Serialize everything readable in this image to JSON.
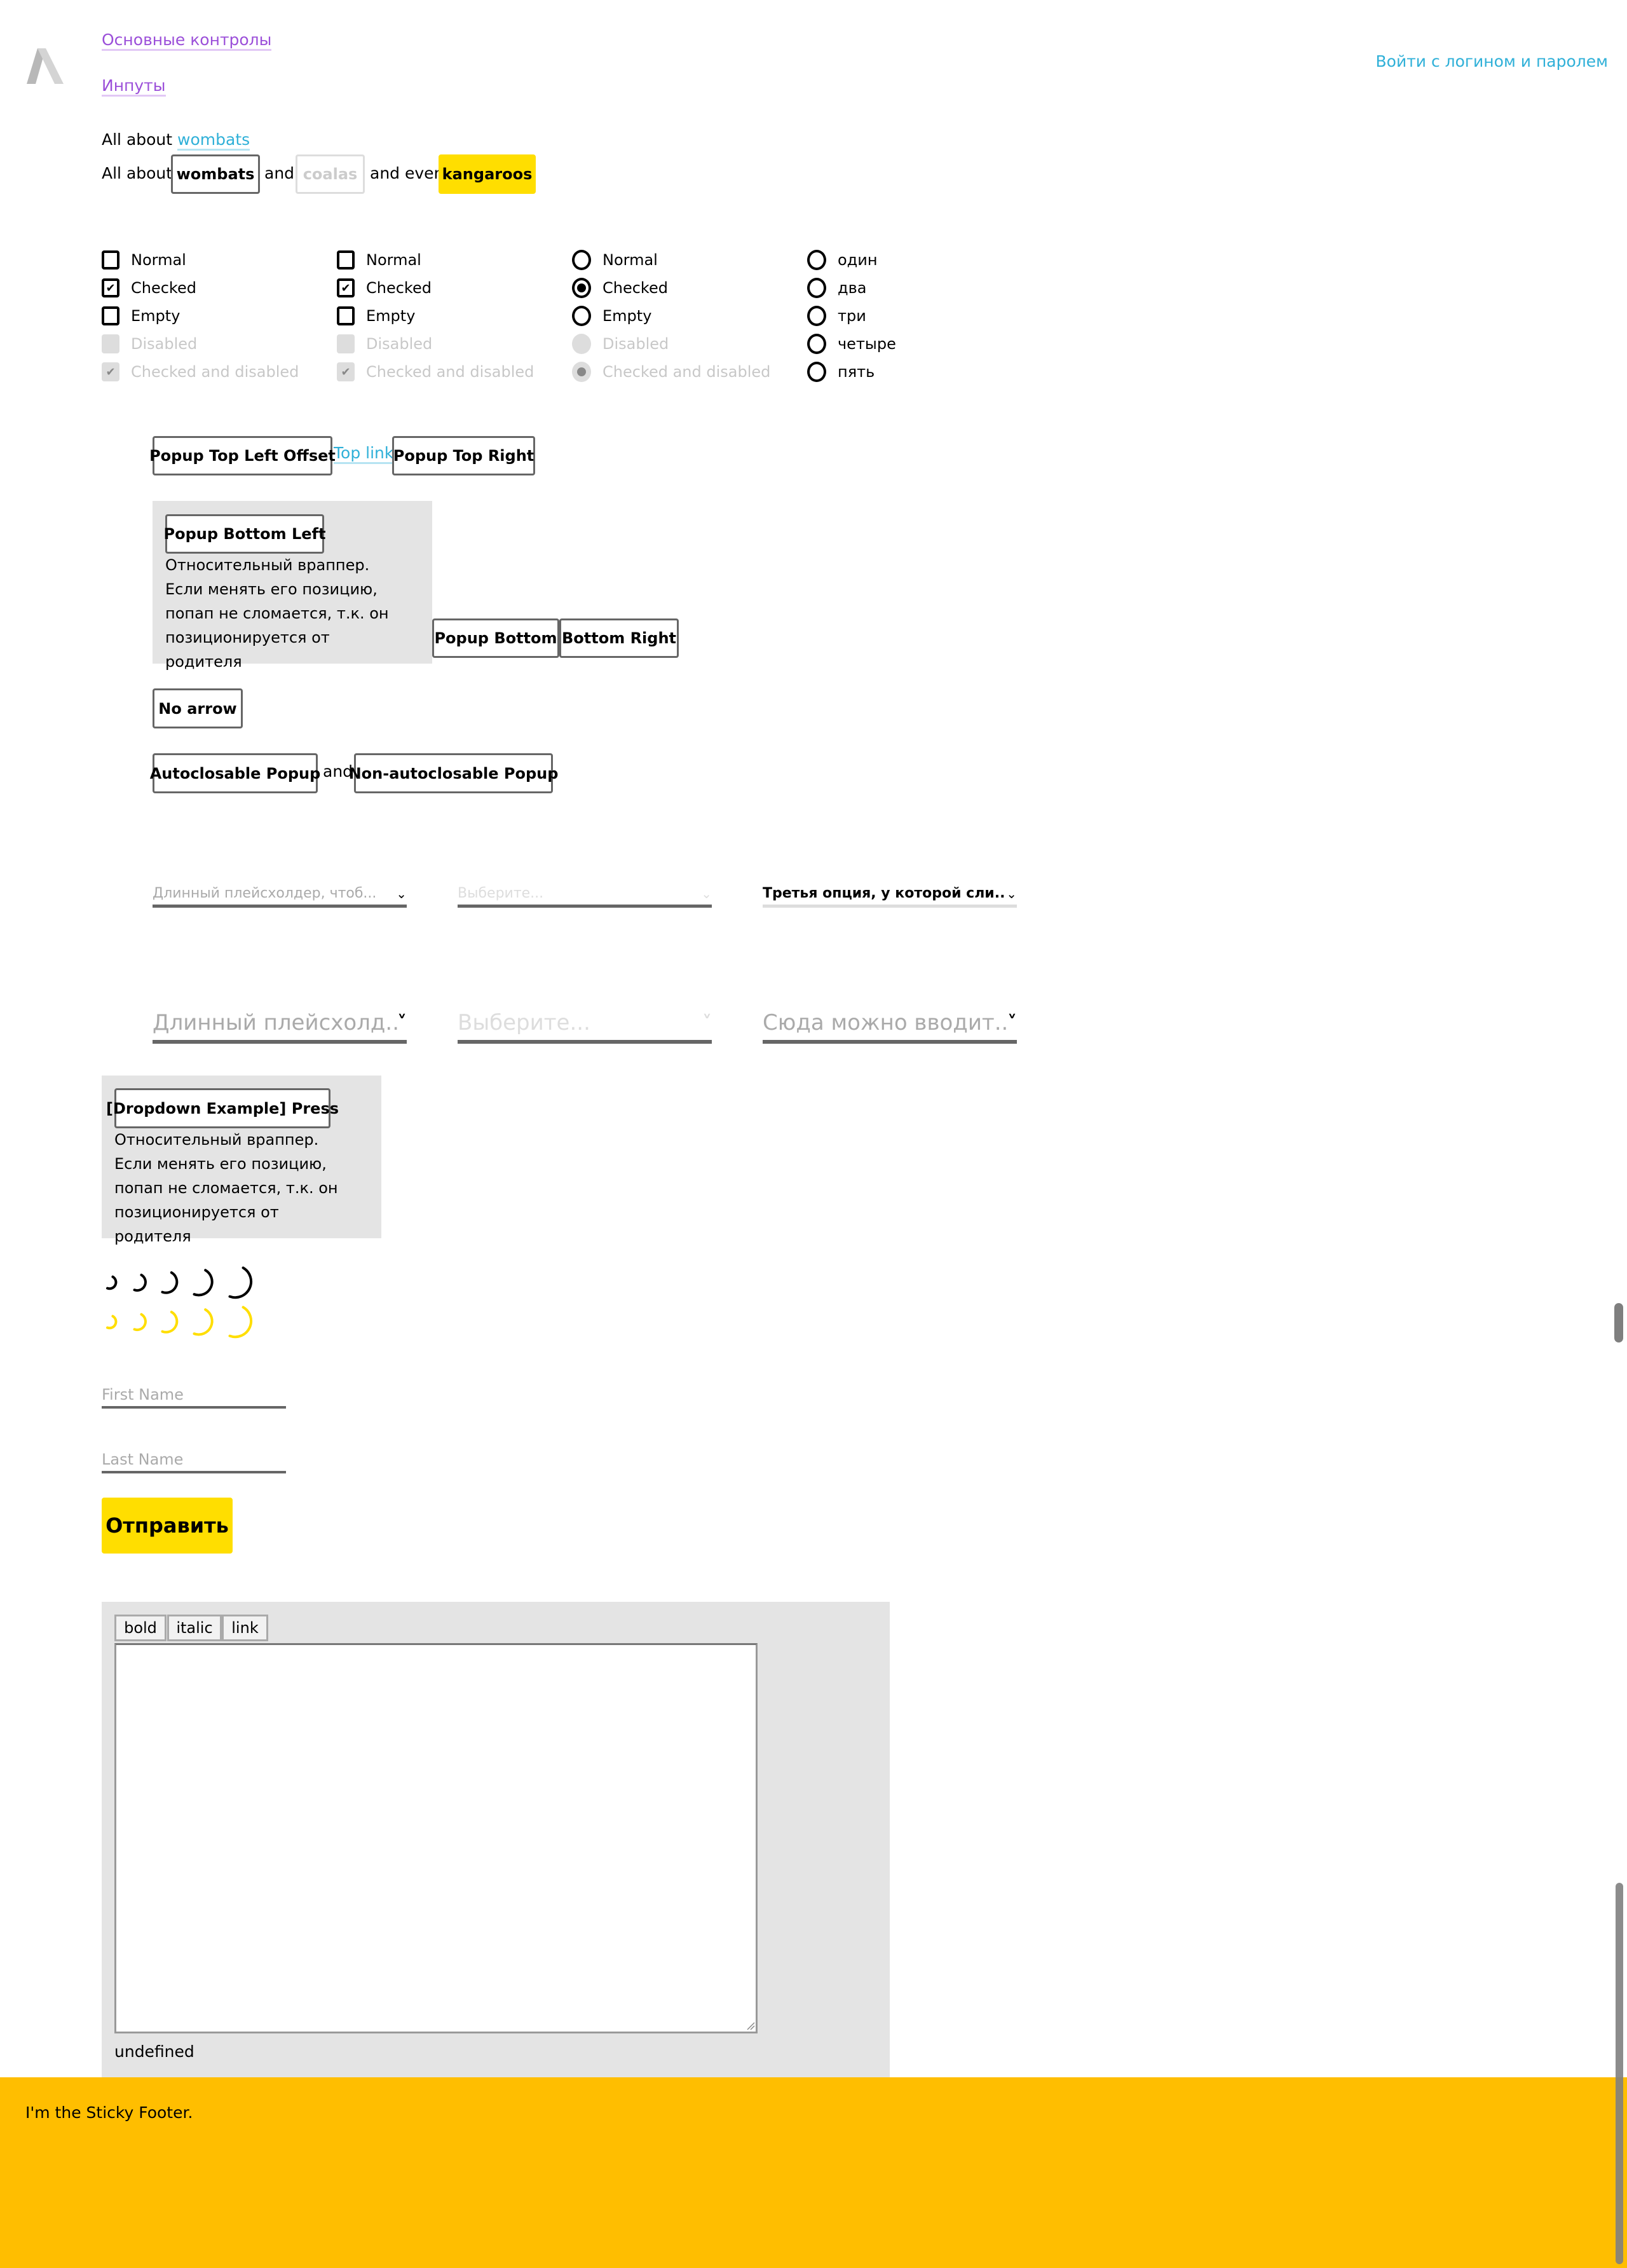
{
  "header": {
    "nav_links": [
      "Основные контролы",
      "Инпуты"
    ],
    "login_link": "Войти с логином и паролем"
  },
  "links_demo": {
    "line1_prefix": "All about",
    "line1_link": "wombats",
    "line2_prefix": "All about",
    "button_wombats": "wombats",
    "and1": "and",
    "button_coalas": "coalas",
    "and_even": "and even",
    "button_kangaroos": "kangaroos"
  },
  "checkbox_groups": [
    {
      "type": "checkbox",
      "items": [
        {
          "label": "Normal",
          "checked": false,
          "disabled": false
        },
        {
          "label": "Checked",
          "checked": true,
          "disabled": false
        },
        {
          "label": "Empty",
          "checked": false,
          "disabled": false
        },
        {
          "label": "Disabled",
          "checked": false,
          "disabled": true
        },
        {
          "label": "Checked and disabled",
          "checked": true,
          "disabled": true
        }
      ]
    },
    {
      "type": "checkbox",
      "items": [
        {
          "label": "Normal",
          "checked": false,
          "disabled": false
        },
        {
          "label": "Checked",
          "checked": true,
          "disabled": false
        },
        {
          "label": "Empty",
          "checked": false,
          "disabled": false
        },
        {
          "label": "Disabled",
          "checked": false,
          "disabled": true
        },
        {
          "label": "Checked and disabled",
          "checked": true,
          "disabled": true
        }
      ]
    },
    {
      "type": "radio",
      "items": [
        {
          "label": "Normal",
          "checked": false,
          "disabled": false
        },
        {
          "label": "Checked",
          "checked": true,
          "disabled": false
        },
        {
          "label": "Empty",
          "checked": false,
          "disabled": false
        },
        {
          "label": "Disabled",
          "checked": false,
          "disabled": true
        },
        {
          "label": "Checked and disabled",
          "checked": true,
          "disabled": true
        }
      ]
    },
    {
      "type": "radio",
      "items": [
        {
          "label": "один",
          "checked": false,
          "disabled": false
        },
        {
          "label": "два",
          "checked": false,
          "disabled": false
        },
        {
          "label": "три",
          "checked": false,
          "disabled": false
        },
        {
          "label": "четыре",
          "checked": false,
          "disabled": false
        },
        {
          "label": "пять",
          "checked": false,
          "disabled": false
        }
      ]
    }
  ],
  "popups": {
    "top_left_offset": "Popup Top Left Offset",
    "top_link": "Top link",
    "top_right": "Popup Top Right",
    "bottom_left": "Popup Bottom Left",
    "wrapper_text": "Относительный враппер. Если менять его позицию, попап не сломается, т.к. он позиционируется от родителя",
    "bottom": "Popup Bottom",
    "bottom_right": "Bottom Right",
    "no_arrow": "No arrow",
    "autoclosable": "Autoclosable Popup",
    "and": "and",
    "non_autoclosable": "Non-autoclosable Popup"
  },
  "selects_small": [
    {
      "value": "Длинный плейсхолдер, чтоб...",
      "placeholder": true,
      "disabled": false
    },
    {
      "value": "Выберите...",
      "placeholder": true,
      "disabled": true
    },
    {
      "value": "Третья опция, у которой сли...",
      "placeholder": false,
      "disabled": false
    }
  ],
  "selects_big": [
    {
      "value": "Длинный плейсхолд...",
      "placeholder": true,
      "disabled": false
    },
    {
      "value": "Выберите...",
      "placeholder": true,
      "disabled": true
    },
    {
      "value": "Сюда можно вводит...",
      "placeholder": true,
      "disabled": false
    }
  ],
  "dropdown_example": {
    "button": "[Dropdown Example] Press",
    "wrapper_text": "Относительный враппер. Если менять его позицию, попап не сломается, т.к. он позиционируется от родителя"
  },
  "spinners": {
    "colors": {
      "dark": "#000000",
      "yellow": "#ffde00"
    },
    "count_per_row": 5
  },
  "form": {
    "first_name_placeholder": "First Name",
    "last_name_placeholder": "Last Name",
    "submit": "Отправить"
  },
  "editor": {
    "toolbar": [
      "bold",
      "italic",
      "link"
    ],
    "content": "",
    "output": "undefined"
  },
  "footer": {
    "text": "I'm the Sticky Footer.",
    "color": "#ffbe00"
  }
}
